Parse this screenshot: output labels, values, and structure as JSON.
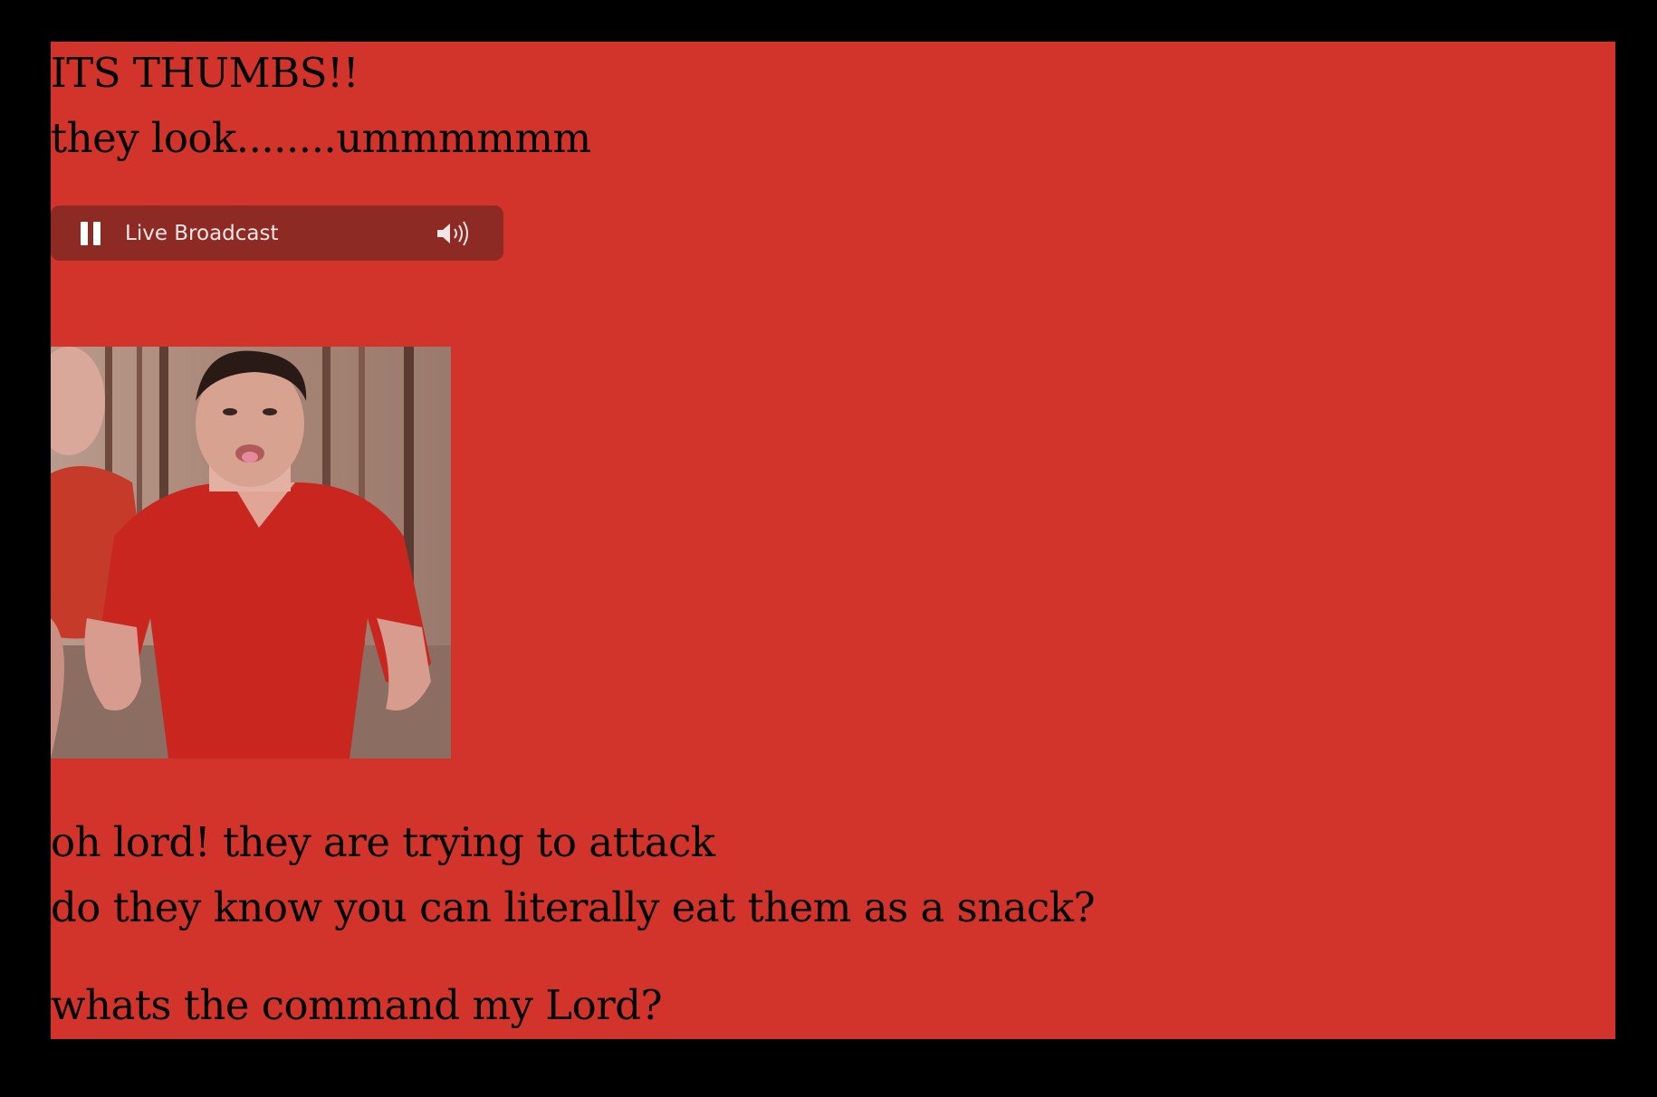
{
  "heading": {
    "title": "ITS THUMBS!!",
    "subtitle": "they look........ummmmmm"
  },
  "audio_player": {
    "label": "Live Broadcast",
    "state": "playing",
    "icons": [
      "pause-icon",
      "speaker-volume-icon"
    ]
  },
  "image": {
    "kind": "photo of a person in a red shirt"
  },
  "body_lines": [
    "oh lord! they are trying to attack",
    "do they know you can literally eat them as a snack?",
    "whats the command my Lord?"
  ],
  "colors": {
    "page_background": "#d2332b",
    "outer_background": "#000000",
    "player_background": "#8e2a24",
    "text": "#000000"
  }
}
